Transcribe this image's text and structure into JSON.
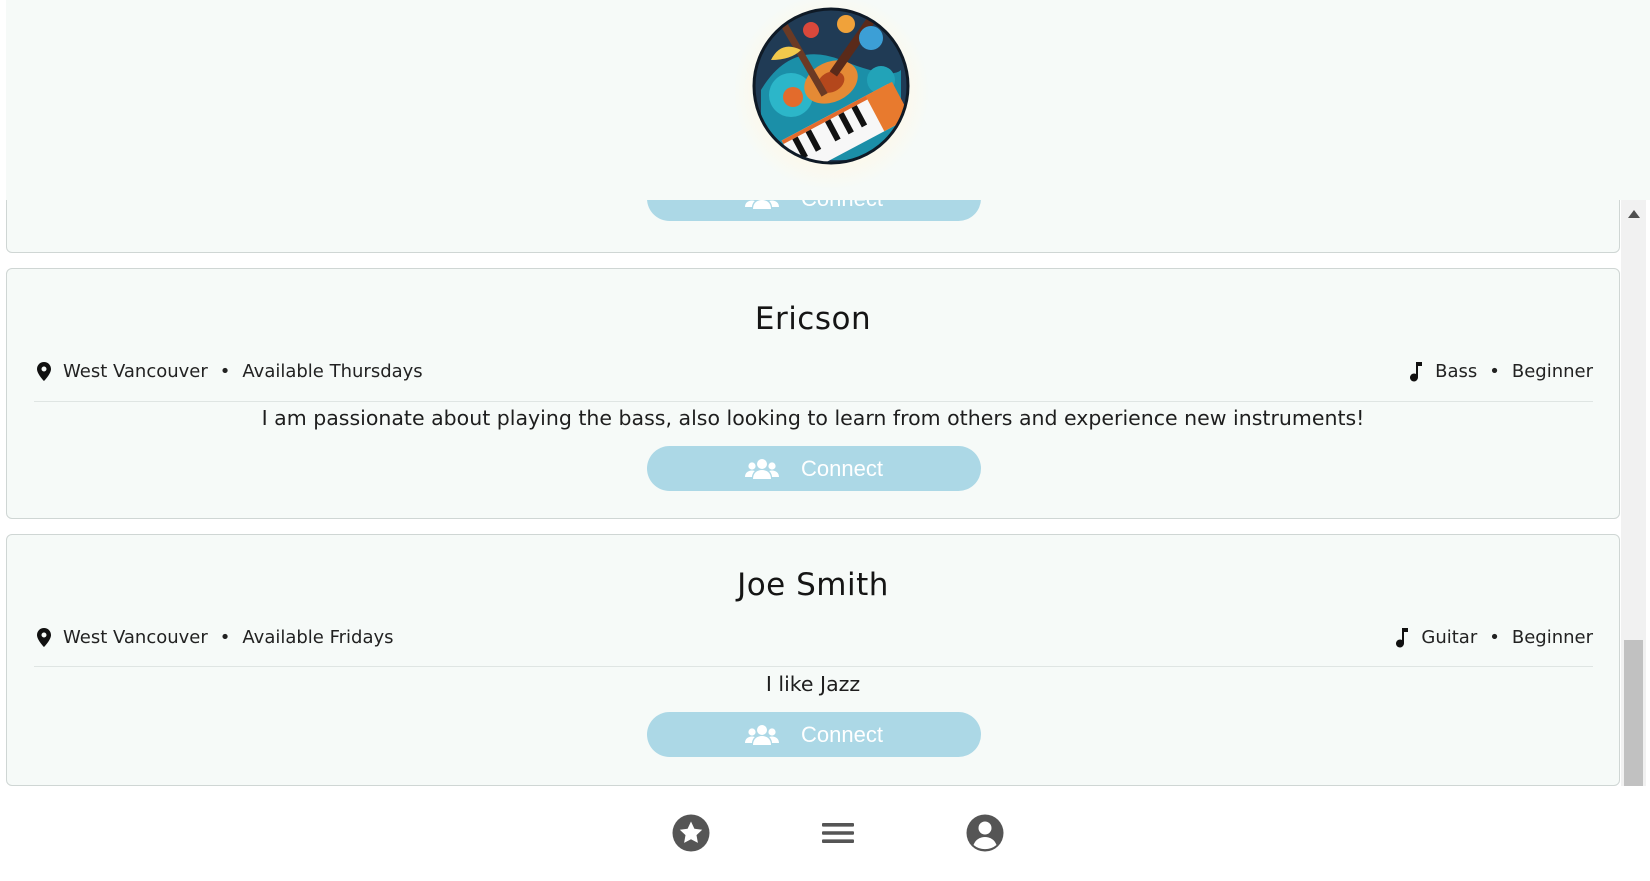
{
  "profiles": [
    {
      "name": "",
      "location": "",
      "availability": "",
      "instrument": "",
      "level": "",
      "bio": "",
      "connect_label": "Connect"
    },
    {
      "name": "Ericson",
      "location": "West Vancouver",
      "availability": "Available Thursdays",
      "instrument": "Bass",
      "level": "Beginner",
      "bio": "I am passionate about playing the bass, also looking to learn from others and experience new instruments!",
      "connect_label": "Connect"
    },
    {
      "name": "Joe Smith",
      "location": "West Vancouver",
      "availability": "Available Fridays",
      "instrument": "Guitar",
      "level": "Beginner",
      "bio": "I like Jazz",
      "connect_label": "Connect"
    }
  ],
  "separator": "•",
  "icons": {
    "location": "map-pin-icon",
    "instrument": "music-note-icon",
    "connect": "users-icon",
    "logo": "music-instruments-logo",
    "nav": [
      "star-icon",
      "menu-icon",
      "user-circle-icon"
    ]
  },
  "colors": {
    "card_background": "#f6faf8",
    "connect_button": "#acd8e6",
    "nav_icon": "#555555"
  }
}
